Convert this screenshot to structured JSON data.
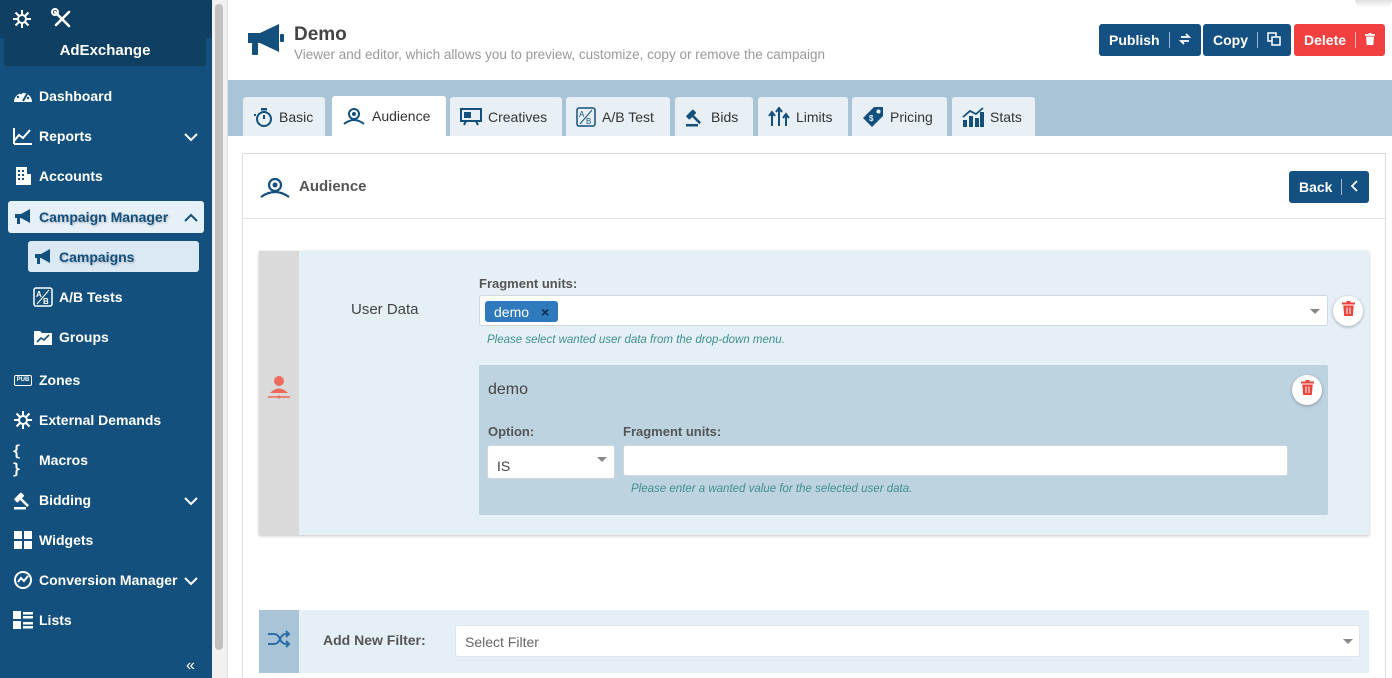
{
  "sidebar": {
    "brand": "AdExchange",
    "items": [
      {
        "label": "Dashboard",
        "icon": "dashboard-icon"
      },
      {
        "label": "Reports",
        "icon": "reports-icon"
      },
      {
        "label": "Accounts",
        "icon": "accounts-icon"
      },
      {
        "label": "Campaign Manager",
        "icon": "megaphone-icon"
      },
      {
        "label": "Zones",
        "icon": "pub-icon"
      },
      {
        "label": "External Demands",
        "icon": "hub-icon"
      },
      {
        "label": "Macros",
        "icon": "braces-icon"
      },
      {
        "label": "Bidding",
        "icon": "gavel-icon"
      },
      {
        "label": "Widgets",
        "icon": "widgets-icon"
      },
      {
        "label": "Conversion Manager",
        "icon": "conversion-icon"
      },
      {
        "label": "Lists",
        "icon": "lists-icon"
      }
    ],
    "sub_items": [
      {
        "label": "Campaigns",
        "icon": "megaphone-icon"
      },
      {
        "label": "A/B Tests",
        "icon": "ab-icon"
      },
      {
        "label": "Groups",
        "icon": "folder-icon"
      }
    ],
    "pub_badge": "PUB",
    "braces": "{ }",
    "collapse": "«"
  },
  "header": {
    "title": "Demo",
    "subtitle": "Viewer and editor, which allows you to preview, customize, copy or remove the campaign",
    "publish_label": "Publish",
    "copy_label": "Copy",
    "delete_label": "Delete"
  },
  "tabs": [
    {
      "label": "Basic"
    },
    {
      "label": "Audience"
    },
    {
      "label": "Creatives"
    },
    {
      "label": "A/B Test"
    },
    {
      "label": "Bids"
    },
    {
      "label": "Limits"
    },
    {
      "label": "Pricing"
    },
    {
      "label": "Stats"
    }
  ],
  "panel": {
    "title": "Audience",
    "back_label": "Back",
    "user_data_label": "User Data",
    "fragment_label": "Fragment units:",
    "chip": "demo",
    "chip_remove": "×",
    "help_select": "Please select wanted user data from the drop-down menu.",
    "sub": {
      "title": "demo",
      "option_label": "Option:",
      "option_value": "IS",
      "fragment_label": "Fragment units:",
      "input_value": "",
      "help_enter": "Please enter a wanted value for the selected user data."
    },
    "add_filter_label": "Add New Filter:",
    "add_filter_placeholder": "Select Filter"
  },
  "colors": {
    "sidebar": "#14507d",
    "primary": "#155082",
    "danger": "#f24040",
    "tabbar": "#a9c4d7"
  }
}
